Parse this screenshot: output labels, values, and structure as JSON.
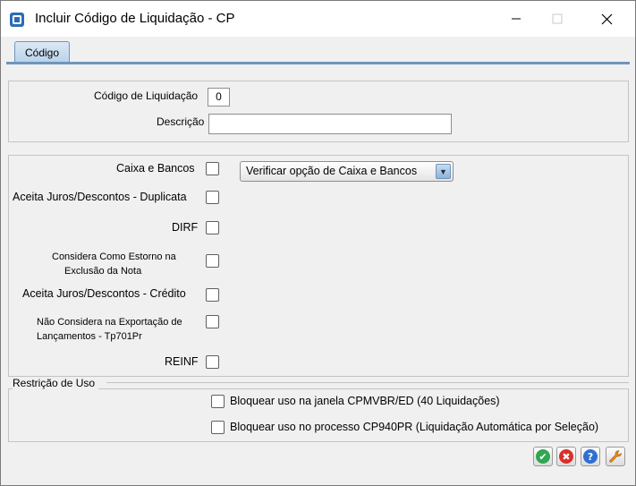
{
  "window": {
    "title": "Incluir Código de Liquidação - CP",
    "minimize_glyph": "—",
    "maximize_glyph": "☐",
    "close_glyph": "✕"
  },
  "tabs": [
    {
      "label": "Código",
      "active": true
    }
  ],
  "identificacao": {
    "codigo_label": "Código de Liquidação",
    "codigo_value": "0",
    "descricao_label": "Descrição",
    "descricao_value": ""
  },
  "opcoes": {
    "caixa_bancos_label": "Caixa e Bancos",
    "caixa_bancos_select": "Verificar opção de Caixa e Bancos",
    "aceita_duplicata_label": "Aceita Juros/Descontos - Duplicata",
    "dirf_label": "DIRF",
    "estorno_label_1": "Considera Como Estorno na",
    "estorno_label_2": "Exclusão da Nota",
    "aceita_credito_label": "Aceita Juros/Descontos - Crédito",
    "exportacao_label_1": "Não Considera na Exportação de",
    "exportacao_label_2": "Lançamentos - Tp701Pr",
    "reinf_label": "REINF"
  },
  "restricao": {
    "group_label": "Restrição de Uso",
    "bloquear_janela_label": "Bloquear uso na janela CPMVBR/ED (40 Liquidações)",
    "bloquear_processo_label": "Bloquear uso no processo CP940PR (Liquidação Automática por Seleção)"
  },
  "actions": {
    "ok_glyph": "✔",
    "cancel_glyph": "✖",
    "help_glyph": "?",
    "tool_glyph": "🔧"
  },
  "colors": {
    "ok": "#2fa84f",
    "cancel": "#d9302a",
    "help": "#2f6fd1",
    "tool": "#e38a1a"
  }
}
